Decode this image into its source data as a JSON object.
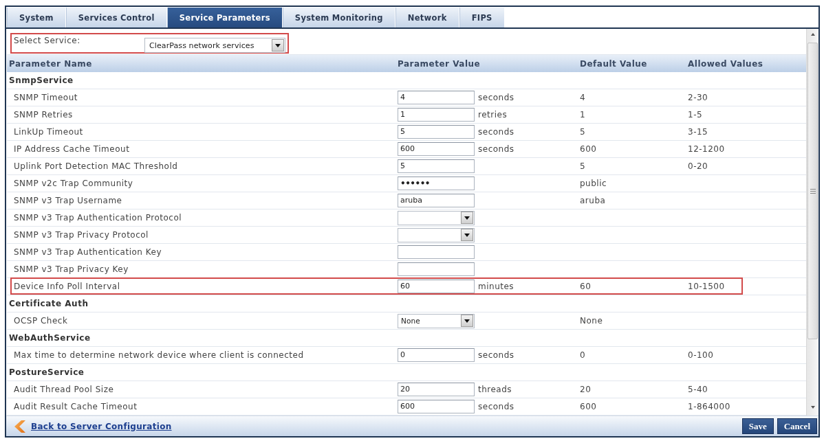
{
  "tabs": [
    {
      "label": "System",
      "selected": false
    },
    {
      "label": "Services Control",
      "selected": false
    },
    {
      "label": "Service Parameters",
      "selected": true
    },
    {
      "label": "System Monitoring",
      "selected": false
    },
    {
      "label": "Network",
      "selected": false
    },
    {
      "label": "FIPS",
      "selected": false
    }
  ],
  "service_selector": {
    "label": "Select Service:",
    "value": "ClearPass network services",
    "highlighted": true
  },
  "table": {
    "columns": [
      "Parameter Name",
      "Parameter Value",
      "Default Value",
      "Allowed Values"
    ],
    "groups": [
      {
        "name": "SnmpService",
        "rows": [
          {
            "name": "SNMP Timeout",
            "kind": "text",
            "value": "4",
            "unit": "seconds",
            "default": "4",
            "allowed": "2-30",
            "highlighted": false
          },
          {
            "name": "SNMP Retries",
            "kind": "text",
            "value": "1",
            "unit": "retries",
            "default": "1",
            "allowed": "1-5",
            "highlighted": false
          },
          {
            "name": "LinkUp Timeout",
            "kind": "text",
            "value": "5",
            "unit": "seconds",
            "default": "5",
            "allowed": "3-15",
            "highlighted": false
          },
          {
            "name": "IP Address Cache Timeout",
            "kind": "text",
            "value": "600",
            "unit": "seconds",
            "default": "600",
            "allowed": "12-1200",
            "highlighted": false
          },
          {
            "name": "Uplink Port Detection MAC Threshold",
            "kind": "text",
            "value": "5",
            "default": "5",
            "allowed": "0-20",
            "highlighted": false
          },
          {
            "name": "SNMP v2c Trap Community",
            "kind": "password",
            "value": "••••••",
            "default": "public",
            "highlighted": false
          },
          {
            "name": "SNMP v3 Trap Username",
            "kind": "text",
            "value": "aruba",
            "default": "aruba",
            "highlighted": false
          },
          {
            "name": "SNMP v3 Trap Authentication Protocol",
            "kind": "select",
            "highlighted": false
          },
          {
            "name": "SNMP v3 Trap Privacy Protocol",
            "kind": "select",
            "highlighted": false
          },
          {
            "name": "SNMP v3 Trap Authentication Key",
            "kind": "text",
            "highlighted": false
          },
          {
            "name": "SNMP v3 Trap Privacy Key",
            "kind": "text",
            "highlighted": false
          },
          {
            "name": "Device Info Poll Interval",
            "kind": "text",
            "value": "60",
            "unit": "minutes",
            "default": "60",
            "allowed": "10-1500",
            "highlighted": true
          }
        ]
      },
      {
        "name": "Certificate Auth",
        "rows": [
          {
            "name": "OCSP Check",
            "kind": "select",
            "value": "None",
            "default": "None",
            "highlighted": false
          }
        ]
      },
      {
        "name": "WebAuthService",
        "rows": [
          {
            "name": "Max time to determine network device where client is connected",
            "kind": "text",
            "value": "0",
            "unit": "seconds",
            "default": "0",
            "allowed": "0-100",
            "highlighted": false
          }
        ]
      },
      {
        "name": "PostureService",
        "rows": [
          {
            "name": "Audit Thread Pool Size",
            "kind": "text",
            "value": "20",
            "unit": "threads",
            "default": "20",
            "allowed": "5-40",
            "highlighted": false
          },
          {
            "name": "Audit Result Cache Timeout",
            "kind": "text",
            "value": "600",
            "unit": "seconds",
            "default": "600",
            "allowed": "1-864000",
            "highlighted": false
          }
        ]
      }
    ]
  },
  "footer": {
    "back_link": "Back to Server Configuration",
    "buttons": [
      "Save",
      "Cancel"
    ]
  }
}
